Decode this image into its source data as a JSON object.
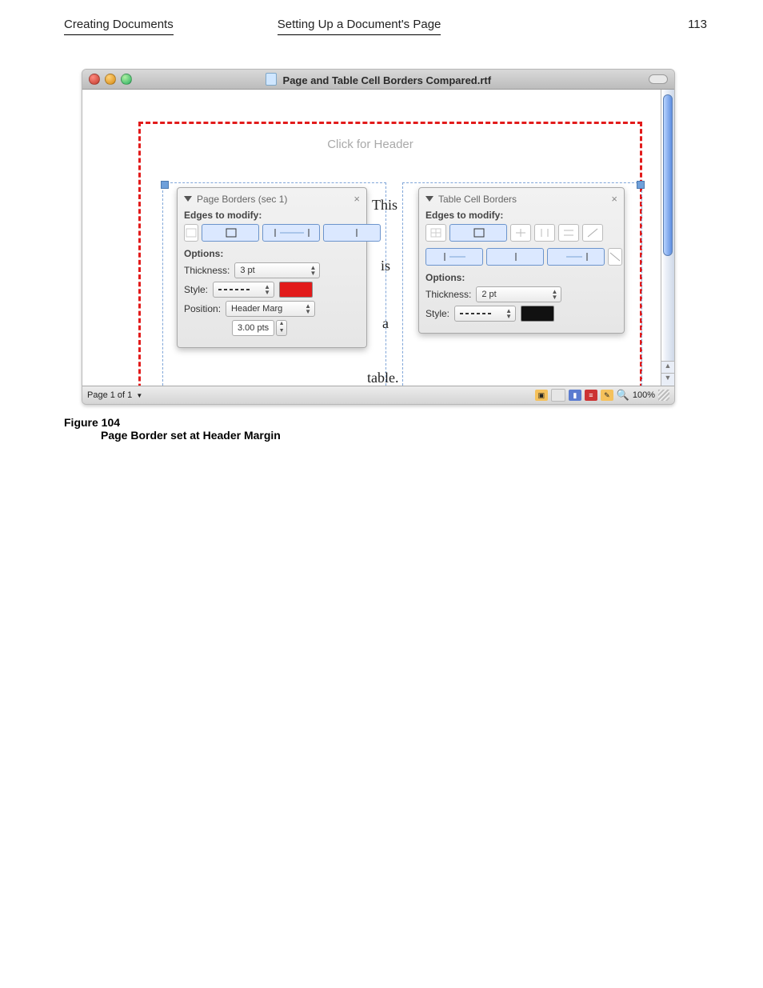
{
  "header": {
    "left": "Creating Documents",
    "center": "Setting Up a Document's Page",
    "page_number": "113"
  },
  "window": {
    "title": "Page and Table Cell Borders Compared.rtf"
  },
  "document": {
    "header_hint": "Click for Header",
    "body_words": [
      "This",
      "is",
      "a",
      "table."
    ]
  },
  "panel_page": {
    "title": "Page Borders (sec 1)",
    "edges_label": "Edges to modify:",
    "options_label": "Options:",
    "thickness_label": "Thickness:",
    "thickness_value": "3 pt",
    "style_label": "Style:",
    "position_label": "Position:",
    "position_value": "Header Marg",
    "position_offset": "3.00 pts"
  },
  "panel_cell": {
    "title": "Table Cell Borders",
    "edges_label": "Edges to modify:",
    "options_label": "Options:",
    "thickness_label": "Thickness:",
    "thickness_value": "2 pt",
    "style_label": "Style:"
  },
  "statusbar": {
    "page": "Page 1 of 1",
    "zoom": "100%"
  },
  "caption": {
    "figure": "Figure 104",
    "text": "Page Border set at Header Margin"
  }
}
